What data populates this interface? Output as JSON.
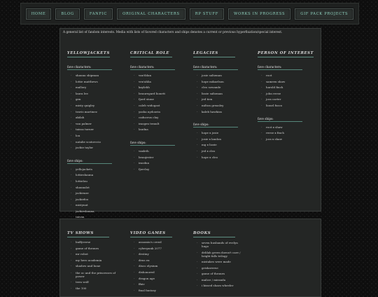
{
  "nav": [
    "HOME",
    "BLOG",
    "FANFIC",
    "ORIGINAL CHARACTERS",
    "RP STUFF",
    "WORKS IN PROGRESS",
    "GIF PACK PROJECTS"
  ],
  "intro": "A general list of fandom interests. Media with lists of favored characters and ships denotes a current or previous hyperfixation/special interest.",
  "columns": [
    {
      "title": "YELLOWJACKETS",
      "sections": [
        {
          "heading": "fave characters:",
          "items": [
            "shauna shipman",
            "lottie matthews",
            "mallory",
            "laura lee",
            "gen",
            "misty quigley",
            "travis martinez",
            "akilah",
            "van palmer",
            "taissa turner",
            "lou",
            "natalie scatorccio",
            "jackie taylor"
          ]
        },
        {
          "heading": "fave ships:",
          "items": [
            "yellojackets",
            "lottieshauna",
            "lottielou",
            "shaunalot",
            "jackieaze",
            "jackiefoo",
            "mistynat",
            "jackieshauna",
            "taivan"
          ]
        }
      ]
    },
    {
      "title": "CRITICAL ROLE",
      "sections": [
        {
          "heading": "fave characters:",
          "items": [
            "vax'ildan",
            "vex'ahlia",
            "kaylehh",
            "beauregard lionett",
            "fjord stone",
            "caleb widogast",
            "yasha nydoorin",
            "caduceus clay",
            "imogen temult",
            "laudna"
          ]
        },
        {
          "heading": "fave ships:",
          "items": [
            "vaxleth",
            "beaujester",
            "imodna",
            "fjorclay"
          ]
        }
      ]
    },
    {
      "title": "LEGACIES",
      "sections": [
        {
          "heading": "fave characters:",
          "items": [
            "josie saltzman",
            "hope mikaelson",
            "cleo sowande",
            "lizzie saltzman",
            "jed tien",
            "milton greasley",
            "kaleb hawkins"
          ]
        },
        {
          "heading": "fave ships:",
          "items": [
            "hope x josie",
            "josie x landon",
            "mg x lizzie",
            "jed x cleo",
            "hope x cleo"
          ]
        }
      ]
    },
    {
      "title": "PERSON OF INTEREST",
      "sections": [
        {
          "heading": "fave characters:",
          "items": [
            "root",
            "sameen shaw",
            "harold finch",
            "john reese",
            "joss carter",
            "lionel fusco"
          ]
        },
        {
          "heading": "fave ships:",
          "items": [
            "root x shaw",
            "reese x finch",
            "joss x shaw"
          ]
        }
      ]
    }
  ],
  "bottom_columns": [
    {
      "title": "TV SHOWS",
      "items": [
        "buffyverse",
        "game of thrones",
        "mr robot",
        "my hero academia",
        "shadow and bone",
        "the oc and the princesses of power",
        "teen wolf",
        "the 100"
      ]
    },
    {
      "title": "VIDEO GAMES",
      "items": [
        "assassin's creed",
        "cyberpunk 2077",
        "destiny",
        "deus ex",
        "disco elysium",
        "dishonored",
        "dragon age",
        "ffxiv",
        "final fantasy"
      ]
    },
    {
      "title": "BOOKS",
      "items": [
        "seven husbands of evelyn hugo",
        "delilah green doesn't care / bright falls trilogy",
        "mistakes were made",
        "grishaverse",
        "game of thrones",
        "malice / miranda",
        "i kissed shara wheeler"
      ]
    }
  ]
}
